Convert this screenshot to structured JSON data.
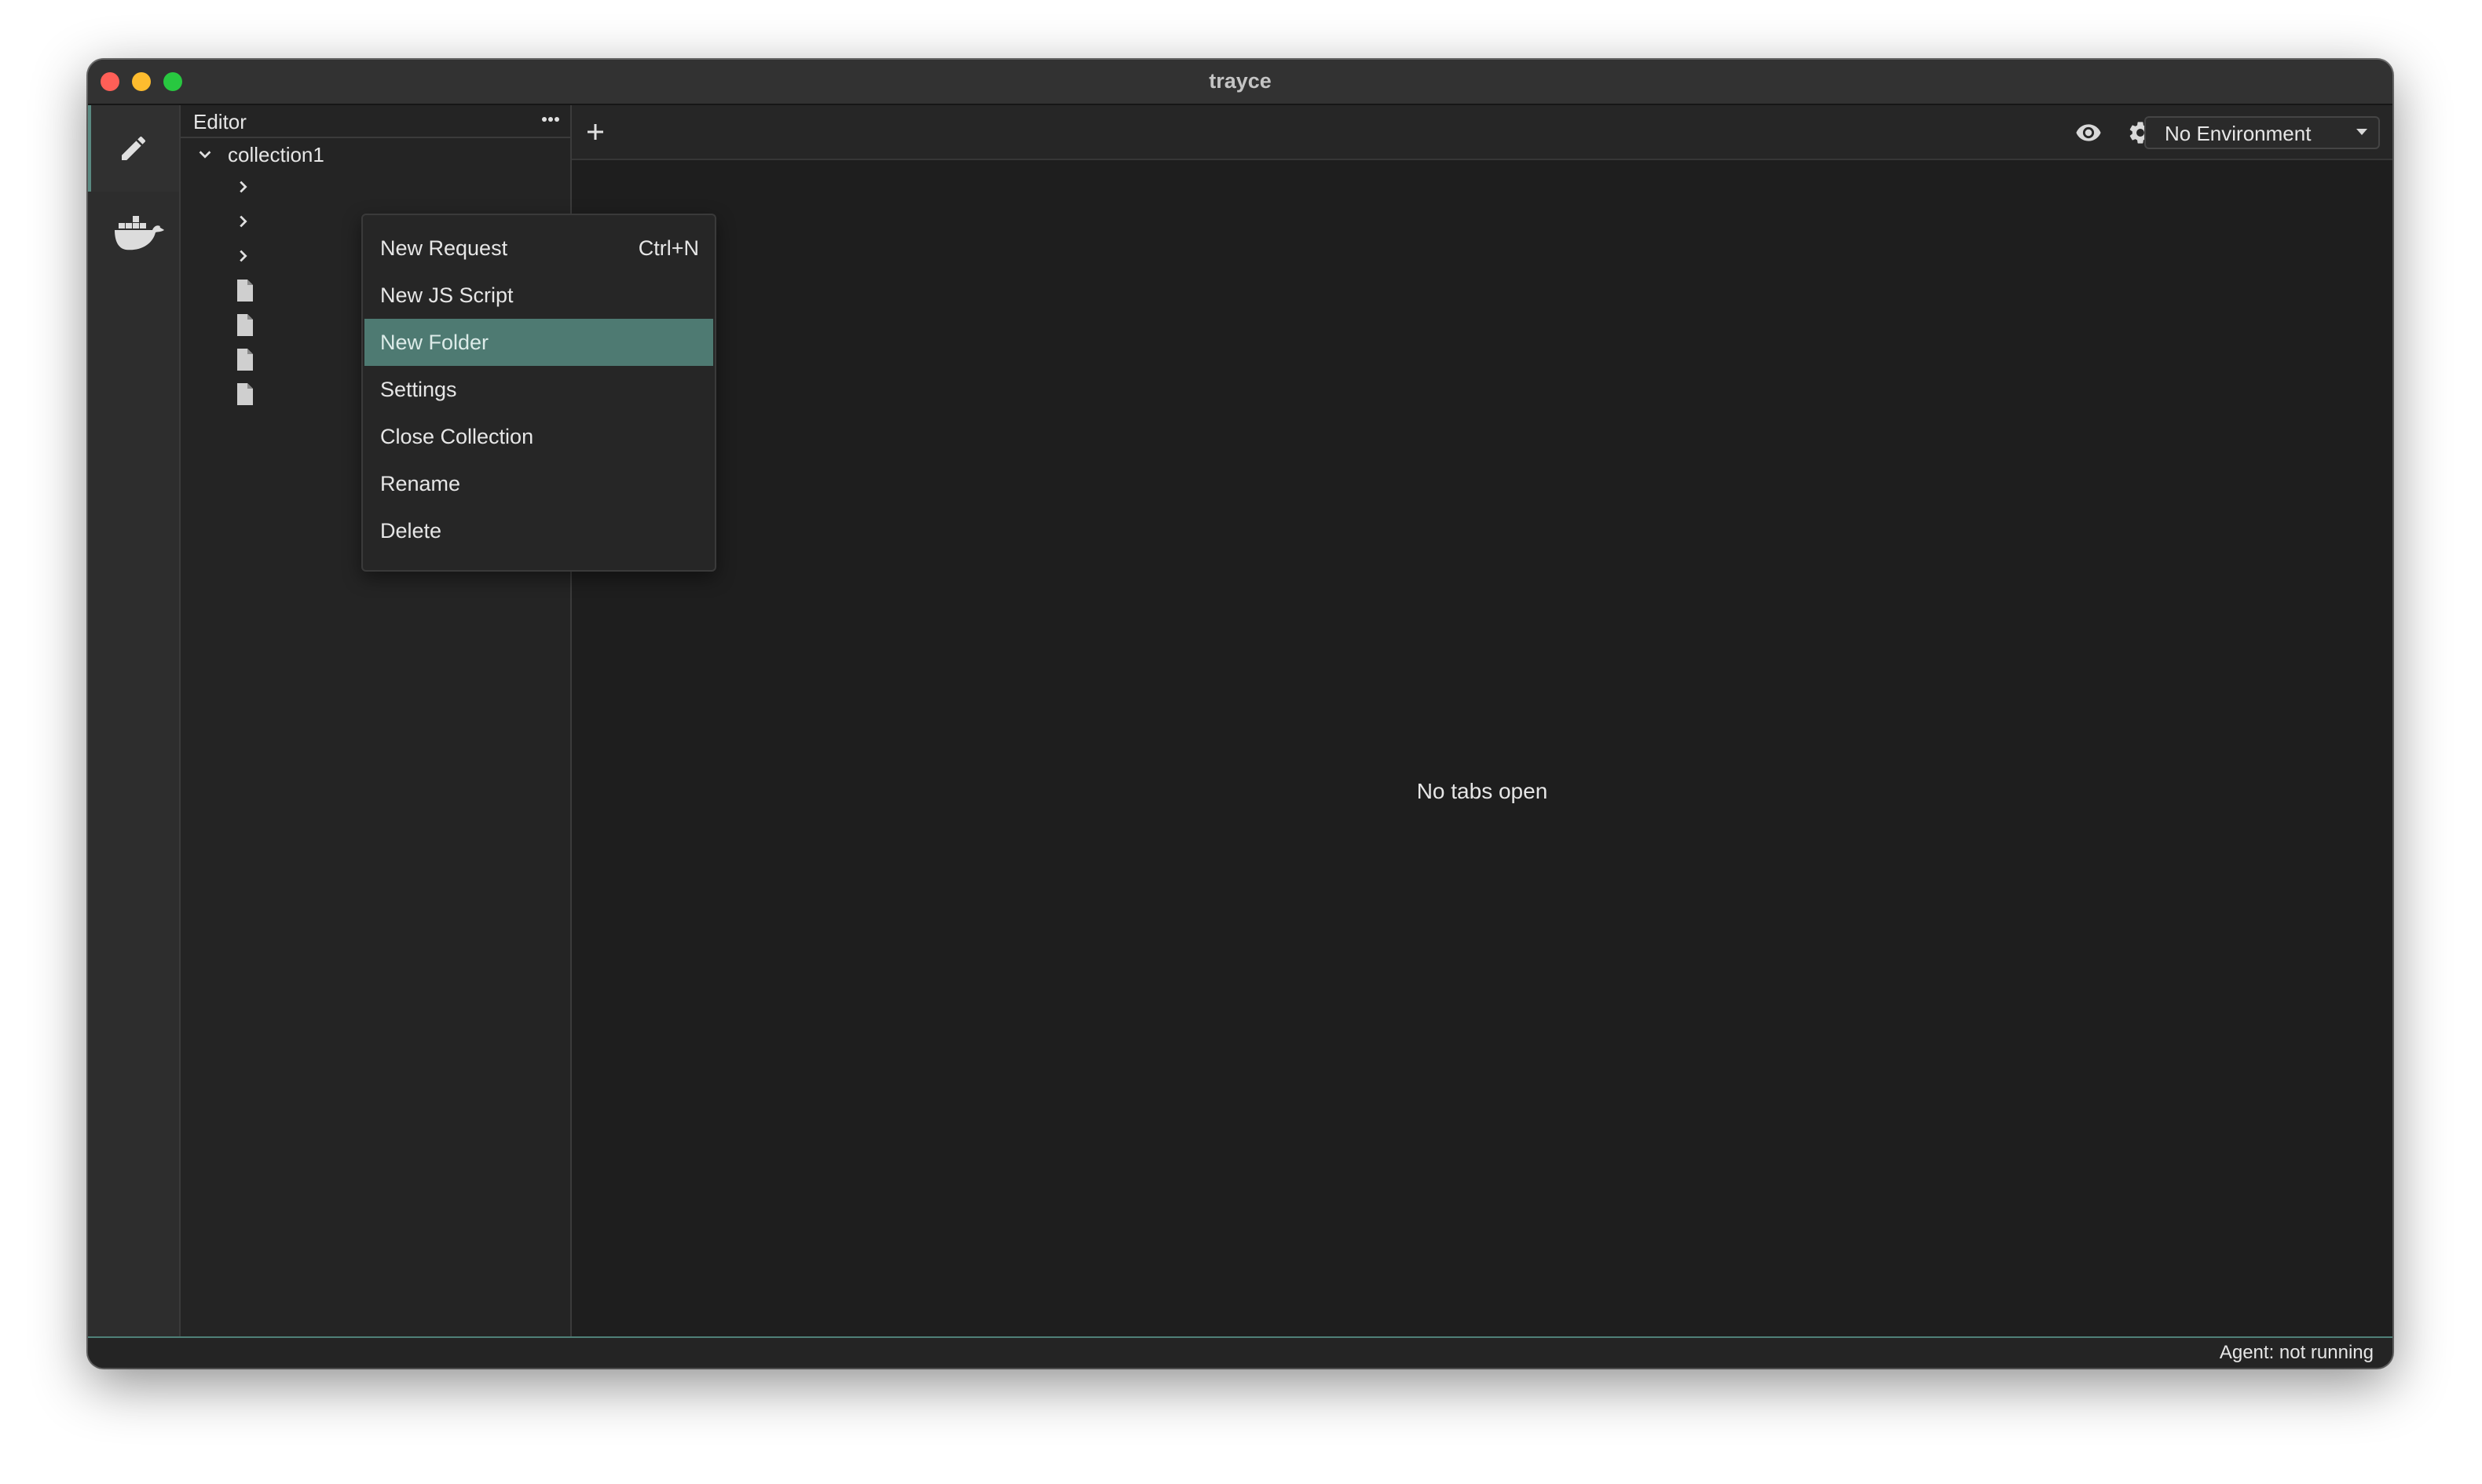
{
  "window": {
    "title": "trayce"
  },
  "activity_bar": {
    "items": [
      {
        "icon": "pencil-icon",
        "active": true
      },
      {
        "icon": "docker-whale-icon",
        "active": false
      }
    ]
  },
  "sidebar": {
    "title": "Editor",
    "tree": [
      {
        "label": "collection1",
        "type": "collection",
        "expanded": true
      },
      {
        "label": "",
        "type": "folder"
      },
      {
        "label": "",
        "type": "folder"
      },
      {
        "label": "",
        "type": "folder"
      },
      {
        "label": "",
        "type": "file"
      },
      {
        "label": "",
        "type": "file"
      },
      {
        "label": "",
        "type": "file"
      },
      {
        "label": "",
        "type": "file"
      }
    ]
  },
  "context_menu": {
    "items": [
      {
        "label": "New Request",
        "shortcut": "Ctrl+N",
        "highlighted": false
      },
      {
        "label": "New JS Script",
        "shortcut": "",
        "highlighted": false
      },
      {
        "label": "New Folder",
        "shortcut": "",
        "highlighted": true
      },
      {
        "label": "Settings",
        "shortcut": "",
        "highlighted": false
      },
      {
        "label": "Close Collection",
        "shortcut": "",
        "highlighted": false
      },
      {
        "label": "Rename",
        "shortcut": "",
        "highlighted": false
      },
      {
        "label": "Delete",
        "shortcut": "",
        "highlighted": false
      }
    ]
  },
  "toolbar": {
    "add_tab_icon": "plus-icon",
    "icons": [
      "eye-icon",
      "gear-icon",
      "globe-icon"
    ],
    "environment": "No Environment"
  },
  "main": {
    "empty_message": "No tabs open"
  },
  "status_bar": {
    "agent_status": "Agent: not running"
  },
  "colors": {
    "accent": "#4e7a72",
    "background": "#1e1e1e",
    "sidebar": "#242424"
  }
}
